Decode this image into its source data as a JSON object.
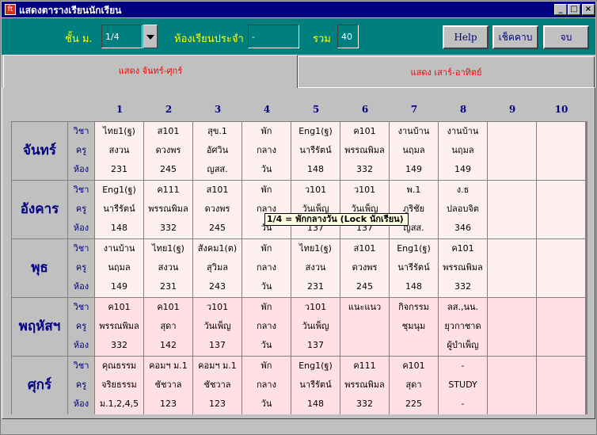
{
  "window": {
    "title": "แสดงตารางเรียนนักเรียน",
    "app_icon": "ft",
    "min": "_",
    "max": "□",
    "close": "×"
  },
  "toolbar": {
    "grade_label": "ชั้น ม.",
    "grade_value": "1/4",
    "room_label": "ห้องเรียนประจำ",
    "room_value": "-",
    "total_label": "รวม",
    "total_value": "40",
    "help_button": "Help",
    "period_button": "เช็คคาบ",
    "exit_button": "จบ"
  },
  "tabs": [
    {
      "label": "แสดง จันทร์-ศุกร์",
      "active": true
    },
    {
      "label": "แสดง เสาร์-อาทิตย์",
      "active": false
    }
  ],
  "columns": [
    "1",
    "2",
    "3",
    "4",
    "5",
    "6",
    "7",
    "8",
    "9",
    "10"
  ],
  "row_labels": [
    "วิชา",
    "ครู",
    "ห้อง"
  ],
  "days": [
    {
      "name": "จันทร์",
      "bg": "#fff0f0",
      "cells": [
        [
          "ไทย1(ฐ)",
          "สงวน",
          "231"
        ],
        [
          "ส101",
          "ดวงพร",
          "245"
        ],
        [
          "สุข.1",
          "อัศวิน",
          "ญสส."
        ],
        [
          "พัก",
          "กลาง",
          "วัน"
        ],
        [
          "Eng1(ฐ)",
          "นารีรัตน์",
          "148"
        ],
        [
          "ค101",
          "พรรณพิมล",
          "332"
        ],
        [
          "งานบ้าน",
          "นฤมล",
          "149"
        ],
        [
          "งานบ้าน",
          "นฤมล",
          "149"
        ],
        [
          "",
          "",
          ""
        ],
        [
          "",
          "",
          ""
        ]
      ]
    },
    {
      "name": "อังคาร",
      "bg": "#fff0f0",
      "cells": [
        [
          "Eng1(ฐ)",
          "นารีรัตน์",
          "148"
        ],
        [
          "ค111",
          "พรรณพิมล",
          "332"
        ],
        [
          "ส101",
          "ดวงพร",
          "245"
        ],
        [
          "พัก",
          "กลาง",
          "วัน"
        ],
        [
          "ว101",
          "วันเพ็ญ",
          "137"
        ],
        [
          "ว101",
          "วันเพ็ญ",
          "137"
        ],
        [
          "พ.1",
          "ภูริชัย",
          "ญสส."
        ],
        [
          "ง.ธ",
          "ปลอบจิต",
          "346"
        ],
        [
          "",
          "",
          ""
        ],
        [
          "",
          "",
          ""
        ]
      ]
    },
    {
      "name": "พุธ",
      "bg": "#fff0f0",
      "cells": [
        [
          "งานบ้าน",
          "นฤมล",
          "149"
        ],
        [
          "ไทย1(ฐ)",
          "สงวน",
          "231"
        ],
        [
          "สังคม1(ต)",
          "สุวิมล",
          "243"
        ],
        [
          "พัก",
          "กลาง",
          "วัน"
        ],
        [
          "ไทย1(ฐ)",
          "สงวน",
          "231"
        ],
        [
          "ส101",
          "ดวงพร",
          "245"
        ],
        [
          "Eng1(ฐ)",
          "นารีรัตน์",
          "148"
        ],
        [
          "ค101",
          "พรรณพิมล",
          "332"
        ],
        [
          "",
          "",
          ""
        ],
        [
          "",
          "",
          ""
        ]
      ]
    },
    {
      "name": "พฤหัสฯ",
      "bg": "#ffe0e4",
      "cells": [
        [
          "ค101",
          "พรรณพิมล",
          "332"
        ],
        [
          "ค101",
          "สุดา",
          "142"
        ],
        [
          "ว101",
          "วันเพ็ญ",
          "137"
        ],
        [
          "พัก",
          "กลาง",
          "วัน"
        ],
        [
          "ว101",
          "วันเพ็ญ",
          "137"
        ],
        [
          "แนะแนว",
          "",
          ""
        ],
        [
          "กิจกรรม",
          "ชุมนุม",
          ""
        ],
        [
          "ลส.,นน.",
          "ยุวกาชาด",
          "ผู้บำเพ็ญ"
        ],
        [
          "",
          "",
          ""
        ],
        [
          "",
          "",
          ""
        ]
      ]
    },
    {
      "name": "ศุกร์",
      "bg": "#ffe0e4",
      "cells": [
        [
          "คุณธรรม",
          "จริยธรรม",
          "ม.1,2,4,5"
        ],
        [
          "คอมฯ ม.1",
          "ชัชวาล",
          "123"
        ],
        [
          "คอมฯ ม.1",
          "ชัชวาล",
          "123"
        ],
        [
          "พัก",
          "กลาง",
          "วัน"
        ],
        [
          "Eng1(ฐ)",
          "นารีรัตน์",
          "148"
        ],
        [
          "ค111",
          "พรรณพิมล",
          "332"
        ],
        [
          "ค101",
          "สุดา",
          "225"
        ],
        [
          "-",
          "STUDY",
          "-"
        ],
        [
          "",
          "",
          ""
        ],
        [
          "",
          "",
          ""
        ]
      ]
    }
  ],
  "tooltip": "1/4 = พักกลางวัน (Lock นักเรียน)"
}
